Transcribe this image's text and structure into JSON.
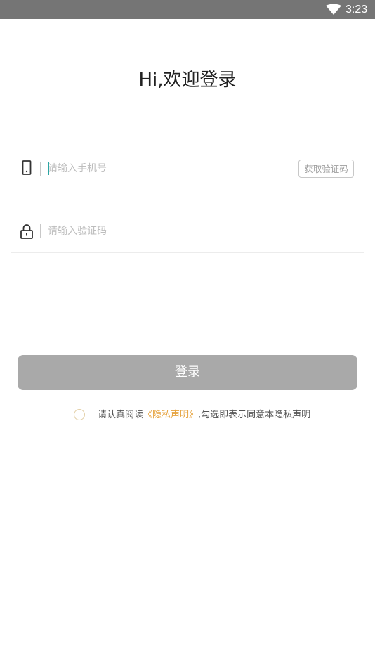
{
  "status_bar": {
    "time": "3:23",
    "wifi_icon": "wifi-icon"
  },
  "title": "Hi,欢迎登录",
  "phone_field": {
    "icon": "phone-icon",
    "placeholder": "请输入手机号",
    "value": "",
    "get_code_label": "获取验证码"
  },
  "code_field": {
    "icon": "lock-icon",
    "placeholder": "请输入验证码",
    "value": ""
  },
  "login_button": {
    "label": "登录"
  },
  "agreement": {
    "checked": false,
    "prefix": "请认真阅读",
    "link": "《隐私声明》",
    "suffix": ",勾选即表示同意本隐私声明"
  },
  "colors": {
    "status_bar": "#757575",
    "button_disabled": "#a9a9a9",
    "link": "#e6a23c",
    "caret": "#2ca6a4"
  }
}
